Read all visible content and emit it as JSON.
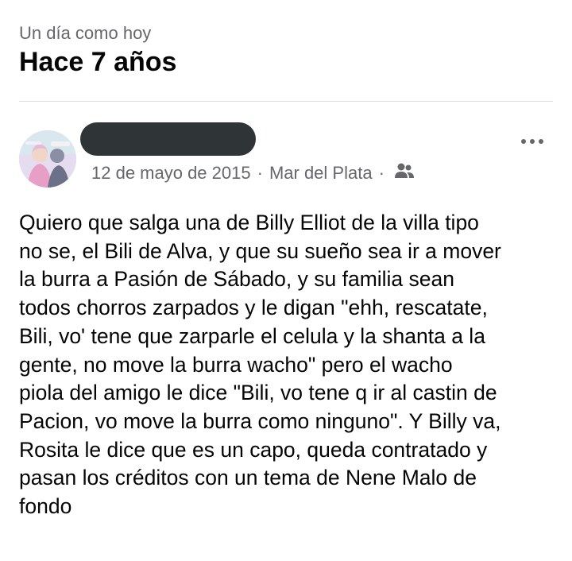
{
  "memory": {
    "subtitle": "Un día como hoy",
    "title": "Hace 7 años"
  },
  "post": {
    "author_name_redacted": true,
    "avatar_icon": "profile-photo",
    "date": "12 de mayo de 2015",
    "separator": "·",
    "location": "Mar del Plata",
    "audience_icon": "friends-icon",
    "more_icon": "ellipsis-icon",
    "text": "Quiero que salga una de Billy Elliot de la villa tipo\nno se, el Bili de Alva, y que su sueño sea ir a mover\nla burra a Pasión de Sábado, y su familia sean\ntodos chorros zarpados y le digan \"ehh, rescatate,\nBili, vo' tene que zarparle el celula y la shanta a la\ngente, no move la burra wacho\" pero el wacho\npiola del amigo le dice \"Bili, vo tene q ir al castin de\nPacion, vo move la burra como ninguno\". Y Billy va,\nRosita le dice que es un capo, queda contratado y\npasan los créditos con un tema de Nene Malo de\nfondo"
  },
  "colors": {
    "secondary_text": "#65676b",
    "primary_text": "#050505",
    "divider": "#dadde1",
    "redaction": "#2f3437"
  }
}
